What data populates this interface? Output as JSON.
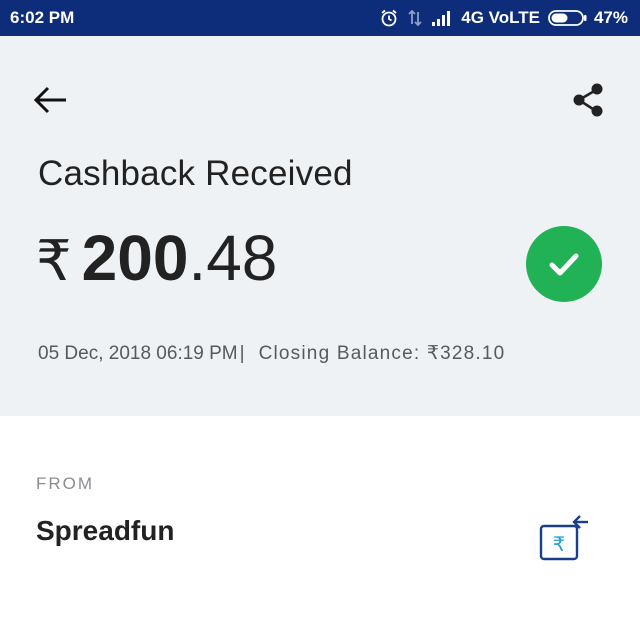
{
  "status_bar": {
    "time": "6:02 PM",
    "network": "4G VoLTE",
    "battery": "47%",
    "icons": [
      "alarm-icon",
      "data-transfer-icon",
      "signal-icon",
      "battery-icon"
    ]
  },
  "header": {
    "back_icon": "back-arrow-icon",
    "share_icon": "share-icon",
    "title": "Cashback Received",
    "amount": {
      "currency": "₹",
      "whole": "200",
      "decimal": ".48"
    },
    "status_icon": "check-circle-icon",
    "datetime": "05 Dec, 2018 06:19 PM",
    "separator": "|",
    "closing_balance": "Closing Balance: ₹328.10"
  },
  "from": {
    "label": "FROM",
    "name": "Spreadfun",
    "icon": "wallet-receive-icon"
  },
  "colors": {
    "status_bar": "#0d2c7a",
    "header_bg": "#eff2f5",
    "success": "#21b255",
    "icon_blue": "#1a3e8c",
    "icon_accent": "#2a9fd6"
  }
}
